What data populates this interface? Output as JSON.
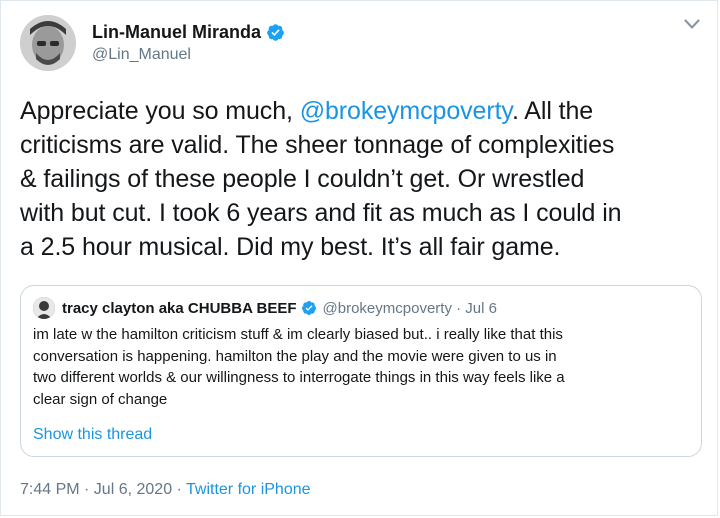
{
  "tweet": {
    "author_name": "Lin-Manuel Miranda",
    "author_handle": "@Lin_Manuel",
    "text_lines": [
      [
        "Appreciate you so much, ",
        "@brokeymcpoverty",
        ". All the"
      ],
      "criticisms are valid. The sheer tonnage of complexities",
      "& failings of these people I couldn’t get. Or wrestled",
      "with but cut. I took 6 years and fit as much as I could in",
      "a 2.5 hour musical. Did my best. It’s all fair game."
    ],
    "timestamp": "7:44 PM · Jul 6, 2020 · ",
    "source": "Twitter for iPhone"
  },
  "quoted_tweet": {
    "author_name": "tracy clayton aka CHUBBA BEEF",
    "author_handle": "@brokeymcpoverty · Jul 6",
    "text_lines": [
      "im late w the hamilton criticism stuff & im clearly biased but.. i really like that this",
      "conversation is happening. hamilton the play and the movie were given to us in",
      "two different worlds & our willingness to interrogate things in this way feels like a",
      "clear sign of change"
    ],
    "thread_link": "Show this thread"
  },
  "icons": {
    "verified": "verified-badge-icon",
    "menu": "chevron-down-icon"
  },
  "colors": {
    "link_blue": "#1b95e0",
    "verified_blue": "#1da1f2",
    "secondary_text": "#657786",
    "border": "#ccd6dd"
  }
}
